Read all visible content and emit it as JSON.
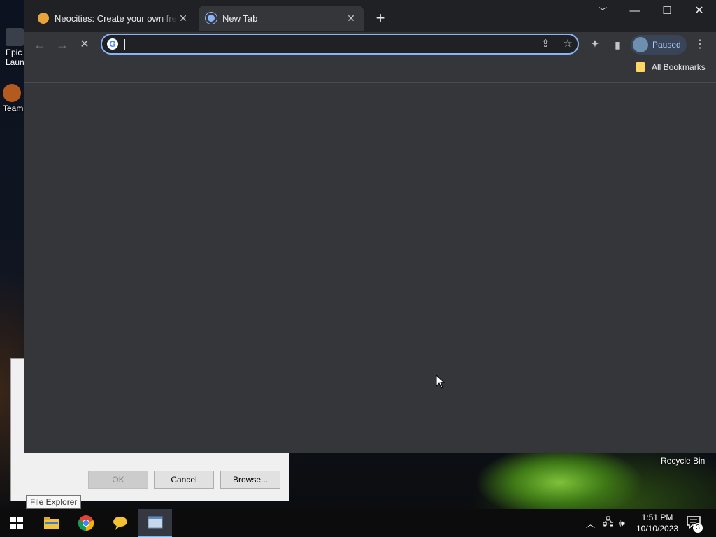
{
  "desktop": {
    "icons": [
      {
        "label_line1": "Epic",
        "label_line2": "Laun"
      },
      {
        "label_line1": "Team",
        "label_line2": ""
      }
    ],
    "recycle_bin_label": "Recycle Bin"
  },
  "run_dialog": {
    "ok_label": "OK",
    "cancel_label": "Cancel",
    "browse_label": "Browse..."
  },
  "tooltip": "File Explorer",
  "chrome": {
    "tabs": [
      {
        "title": "Neocities: Create your own free website!",
        "favicon": "neocities-cat-icon",
        "active": false
      },
      {
        "title": "New Tab",
        "favicon": "chrome-newtab-icon",
        "active": true
      }
    ],
    "omnibox": {
      "value": "",
      "placeholder": ""
    },
    "profile_label": "Paused",
    "bookmarks_folder": "All Bookmarks",
    "accent_color": "#8ab4f8"
  },
  "taskbar": {
    "time": "1:51 PM",
    "date": "10/10/2023",
    "notification_count": "3"
  }
}
